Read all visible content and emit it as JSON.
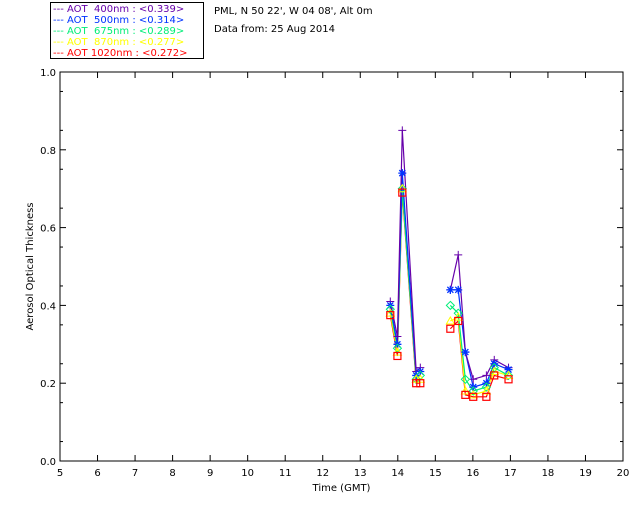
{
  "header": {
    "site": "PML, N 50 22', W 04 08', Alt 0m",
    "date": "Data from: 25 Aug 2014"
  },
  "chart_data": {
    "type": "line",
    "title": "",
    "xlabel": "Time (GMT)",
    "ylabel": "Aerosol Optical Thickness",
    "xlim": [
      5,
      20
    ],
    "ylim": [
      0,
      1
    ],
    "xticks": [
      "5",
      "6",
      "7",
      "8",
      "9",
      "10",
      "11",
      "12",
      "13",
      "14",
      "15",
      "16",
      "17",
      "18",
      "19",
      "20"
    ],
    "yticks": [
      "0.0",
      "0.2",
      "0.4",
      "0.6",
      "0.8",
      "1.0"
    ],
    "grid": false,
    "legend_position": "top-left",
    "x": [
      13.8,
      13.99,
      14.12,
      14.49,
      14.6,
      15.4,
      15.61,
      15.8,
      16.01,
      16.36,
      16.57,
      16.95
    ],
    "series": [
      {
        "name": "AOT  400nm : <0.339>",
        "color": "#6600aa",
        "marker": "plus",
        "values": [
          0.41,
          0.32,
          0.85,
          0.23,
          0.24,
          0.44,
          0.53,
          0.28,
          0.21,
          0.22,
          0.26,
          0.24
        ]
      },
      {
        "name": "AOT  500nm : <0.314>",
        "color": "#0033ff",
        "marker": "asterisk",
        "values": [
          0.4,
          0.3,
          0.74,
          0.22,
          0.23,
          0.44,
          0.44,
          0.28,
          0.19,
          0.2,
          0.25,
          0.235
        ]
      },
      {
        "name": "AOT  675nm : <0.289>",
        "color": "#00ee77",
        "marker": "diamond",
        "values": [
          0.39,
          0.29,
          0.7,
          0.21,
          0.22,
          0.4,
          0.38,
          0.21,
          0.18,
          0.19,
          0.24,
          0.22
        ]
      },
      {
        "name": "AOT  870nm : <0.277>",
        "color": "#ffff00",
        "marker": "triangle",
        "values": [
          0.38,
          0.28,
          0.7,
          0.21,
          0.21,
          0.36,
          0.37,
          0.18,
          0.17,
          0.18,
          0.23,
          0.22
        ]
      },
      {
        "name": "AOT 1020nm : <0.272>",
        "color": "#ff0000",
        "marker": "square",
        "values": [
          0.375,
          0.27,
          0.69,
          0.2,
          0.2,
          0.34,
          0.36,
          0.17,
          0.165,
          0.165,
          0.22,
          0.21
        ]
      }
    ]
  }
}
